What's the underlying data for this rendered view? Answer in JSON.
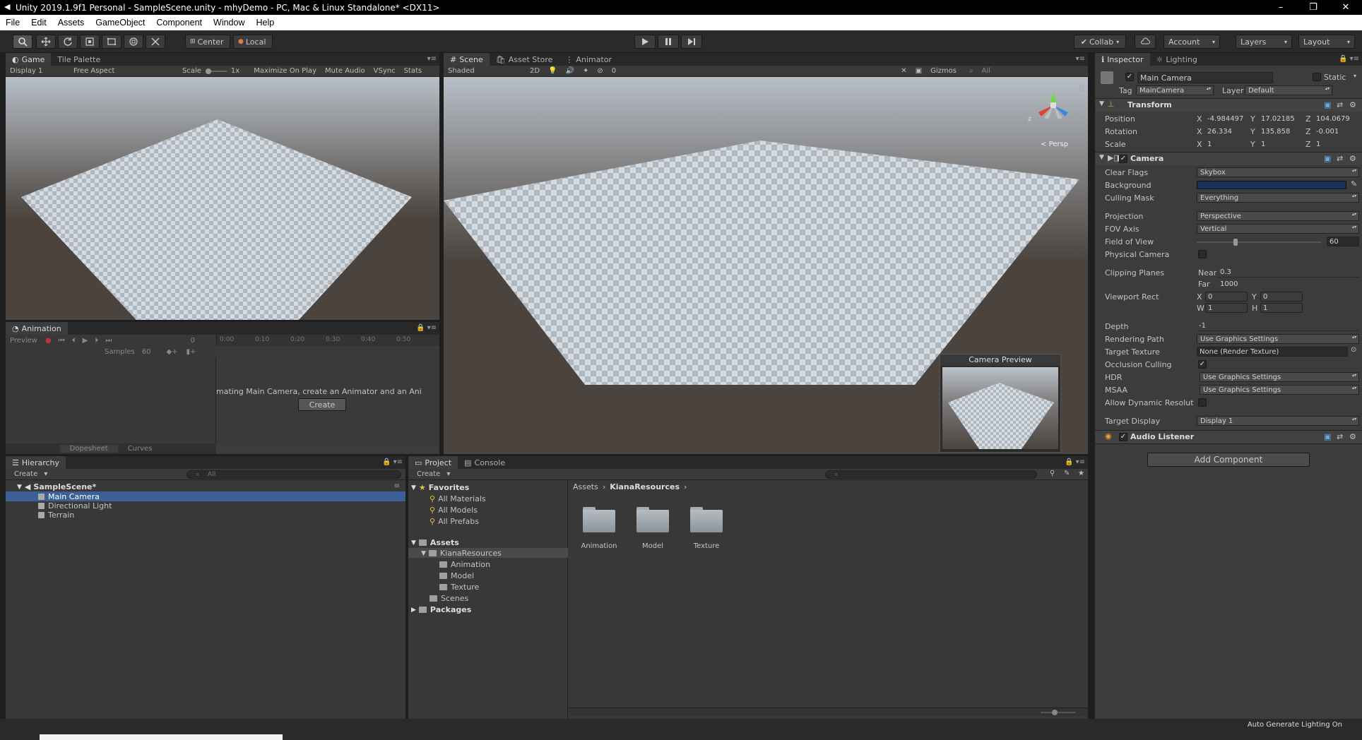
{
  "window": {
    "title": "Unity 2019.1.9f1 Personal - SampleScene.unity - mhyDemo - PC, Mac & Linux Standalone* <DX11>",
    "minimize": "–",
    "maximize": "❐",
    "close": "✕"
  },
  "menu": [
    "File",
    "Edit",
    "Assets",
    "GameObject",
    "Component",
    "Window",
    "Help"
  ],
  "toolbar": {
    "pivot": "Center",
    "space": "Local",
    "collab": "Collab",
    "account": "Account",
    "layers": "Layers",
    "layout": "Layout"
  },
  "game": {
    "tabs": [
      "Game",
      "Tile Palette"
    ],
    "display": "Display 1",
    "aspect": "Free Aspect",
    "scale_label": "Scale",
    "scale_value": "1x",
    "maximize": "Maximize On Play",
    "mute": "Mute Audio",
    "vsync": "VSync",
    "stats": "Stats"
  },
  "scene": {
    "tabs": [
      "Scene",
      "Asset Store",
      "Animator"
    ],
    "shading": "Shaded",
    "mode2d": "2D",
    "hidden_count": "0",
    "gizmos": "Gizmos",
    "search": "All",
    "persp": "Persp",
    "axis_z": "z",
    "camera_preview": "Camera Preview"
  },
  "animation": {
    "tab": "Animation",
    "preview": "Preview",
    "frame": "0",
    "samples_label": "Samples",
    "samples_value": "60",
    "ticks": [
      "0:00",
      "0:10",
      "0:20",
      "0:30",
      "0:40",
      "0:50"
    ],
    "message": "mating Main Camera, create an Animator and an Ani",
    "create": "Create",
    "dopesheet": "Dopesheet",
    "curves": "Curves"
  },
  "hierarchy": {
    "tab": "Hierarchy",
    "create": "Create",
    "search": "All",
    "scene": "SampleScene*",
    "items": [
      "Main Camera",
      "Directional Light",
      "Terrain"
    ]
  },
  "project": {
    "tabs": [
      "Project",
      "Console"
    ],
    "create": "Create",
    "favorites": "Favorites",
    "fav_items": [
      "All Materials",
      "All Models",
      "All Prefabs"
    ],
    "assets": "Assets",
    "kiana": "KianaResources",
    "kiana_children": [
      "Animation",
      "Model",
      "Texture"
    ],
    "scenes": "Scenes",
    "packages": "Packages",
    "breadcrumb": [
      "Assets",
      "KianaResources"
    ],
    "folders": [
      "Animation",
      "Model",
      "Texture"
    ]
  },
  "inspector": {
    "tabs": [
      "Inspector",
      "Lighting"
    ],
    "object_name": "Main Camera",
    "static": "Static",
    "tag_label": "Tag",
    "tag": "MainCamera",
    "layer_label": "Layer",
    "layer": "Default",
    "transform": {
      "title": "Transform",
      "position": {
        "label": "Position",
        "x": "-4.984497",
        "y": "17.02185",
        "z": "104.0679"
      },
      "rotation": {
        "label": "Rotation",
        "x": "26.334",
        "y": "135.858",
        "z": "-0.001"
      },
      "scale": {
        "label": "Scale",
        "x": "1",
        "y": "1",
        "z": "1"
      }
    },
    "camera": {
      "title": "Camera",
      "clear_flags_label": "Clear Flags",
      "clear_flags": "Skybox",
      "background_label": "Background",
      "background_color": "#19305a",
      "culling_label": "Culling Mask",
      "culling": "Everything",
      "projection_label": "Projection",
      "projection": "Perspective",
      "fov_axis_label": "FOV Axis",
      "fov_axis": "Vertical",
      "fov_label": "Field of View",
      "fov": "60",
      "fov_fraction": 0.31,
      "physical_label": "Physical Camera",
      "clipping_label": "Clipping Planes",
      "near_label": "Near",
      "near": "0.3",
      "far_label": "Far",
      "far": "1000",
      "viewport_label": "Viewport Rect",
      "vx": "0",
      "vy": "0",
      "vw": "1",
      "vh": "1",
      "depth_label": "Depth",
      "depth": "-1",
      "rendering_label": "Rendering Path",
      "rendering": "Use Graphics Settings",
      "target_texture_label": "Target Texture",
      "target_texture": "None (Render Texture)",
      "occlusion_label": "Occlusion Culling",
      "hdr_label": "HDR",
      "hdr": "Use Graphics Settings",
      "msaa_label": "MSAA",
      "msaa": "Use Graphics Settings",
      "dynamic_label": "Allow Dynamic Resolut",
      "target_display_label": "Target Display",
      "target_display": "Display 1"
    },
    "audio_listener": "Audio Listener",
    "add_component": "Add Component"
  },
  "status": {
    "right": "Auto Generate Lighting On"
  },
  "axis": {
    "x": "X",
    "y": "Y",
    "z": "Z",
    "w": "W",
    "h": "H"
  },
  "colors": {
    "selection": "#3e5f96",
    "accent": "#2e8bd8"
  }
}
